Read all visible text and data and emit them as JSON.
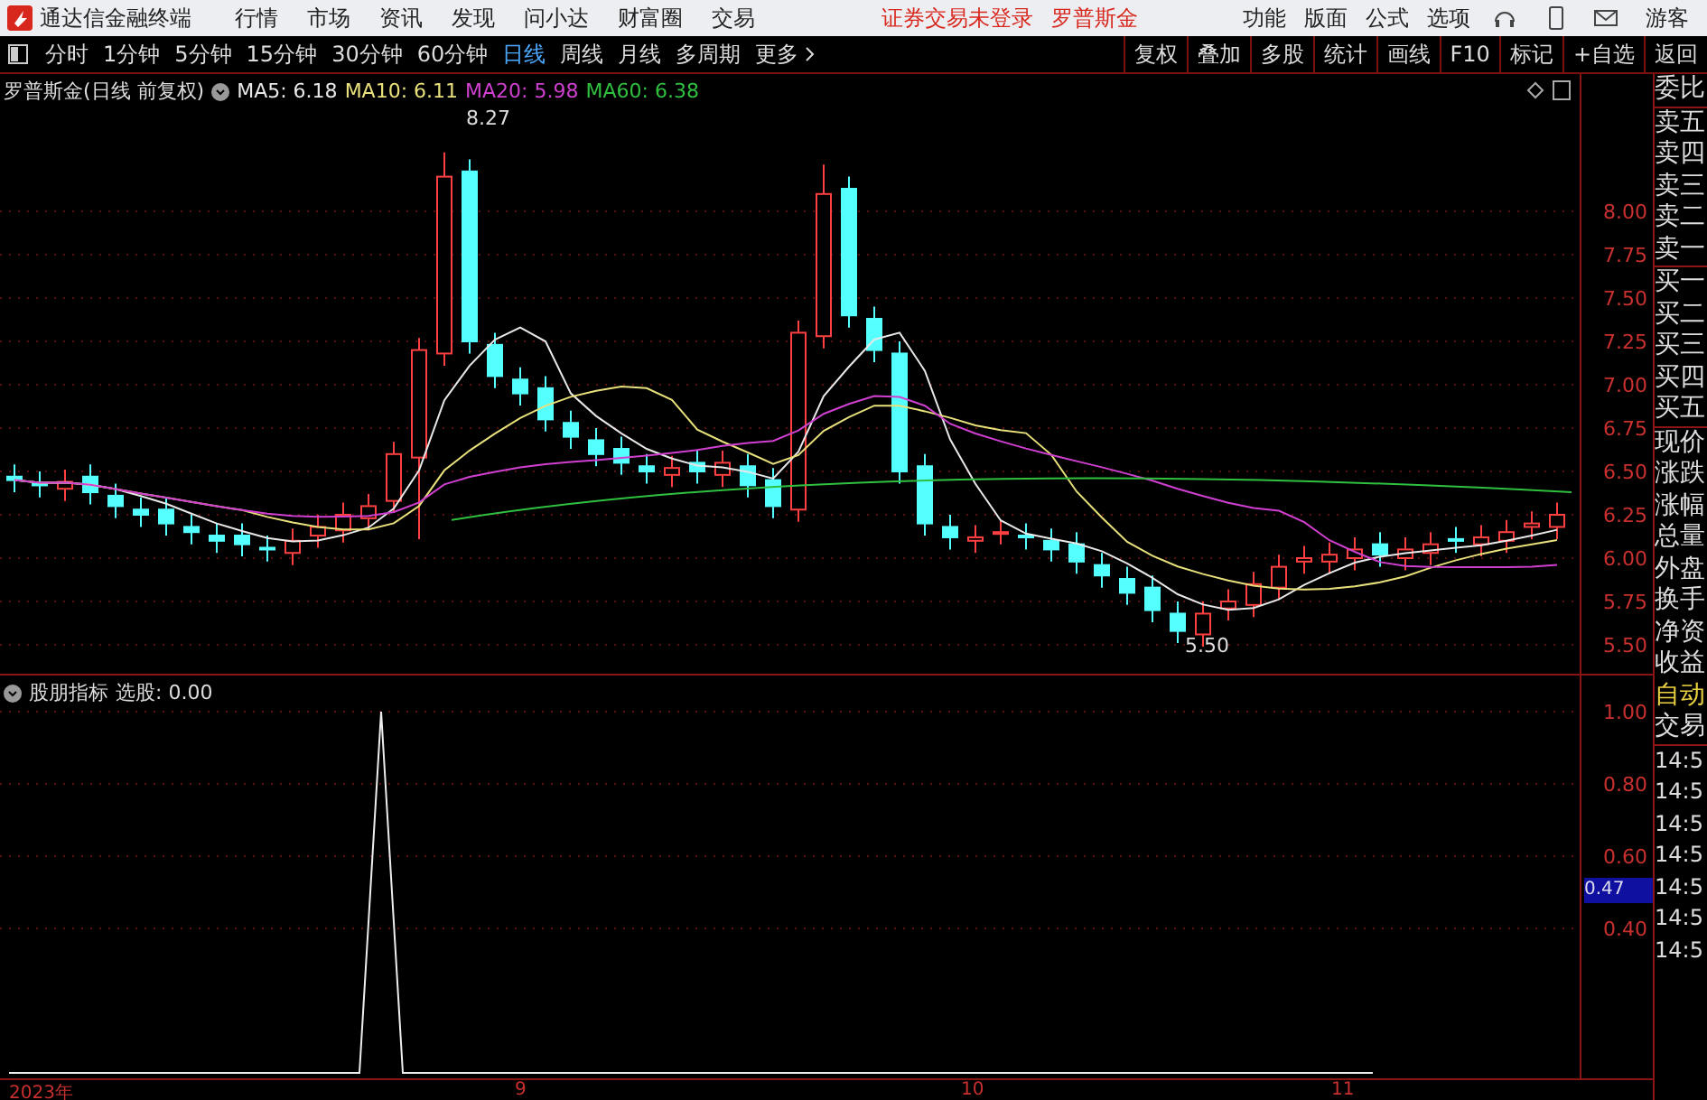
{
  "app": {
    "title": "通达信金融终端"
  },
  "menu": [
    "行情",
    "市场",
    "资讯",
    "发现",
    "问小达",
    "财富圈",
    "交易"
  ],
  "login_status": "证券交易未登录",
  "stock_name": "罗普斯金",
  "top_actions": [
    "功能",
    "版面",
    "公式",
    "选项"
  ],
  "user": "游客",
  "periods": [
    {
      "label": "分时",
      "selected": false
    },
    {
      "label": "1分钟",
      "selected": false
    },
    {
      "label": "5分钟",
      "selected": false
    },
    {
      "label": "15分钟",
      "selected": false
    },
    {
      "label": "30分钟",
      "selected": false
    },
    {
      "label": "60分钟",
      "selected": false
    },
    {
      "label": "日线",
      "selected": true
    },
    {
      "label": "周线",
      "selected": false
    },
    {
      "label": "月线",
      "selected": false
    },
    {
      "label": "多周期",
      "selected": false
    }
  ],
  "more": "更多",
  "tools": [
    "复权",
    "叠加",
    "多股",
    "统计",
    "画线",
    "F10",
    "标记",
    "+自选",
    "返回"
  ],
  "chart": {
    "title": "罗普斯金(日线 前复权)",
    "ma": [
      {
        "label": "MA5: 6.18",
        "color": "#e8e8e8"
      },
      {
        "label": "MA10: 6.11",
        "color": "#e8e07a"
      },
      {
        "label": "MA20: 5.98",
        "color": "#d040d0"
      },
      {
        "label": "MA60: 6.38",
        "color": "#30c040"
      }
    ],
    "high_label": "8.27",
    "low_label": "5.50",
    "yticks": [
      "8.00",
      "7.75",
      "7.50",
      "7.25",
      "7.00",
      "6.75",
      "6.50",
      "6.25",
      "6.00",
      "5.75",
      "5.50"
    ]
  },
  "indicator": {
    "title": "股朋指标",
    "reading": "选股: 0.00",
    "yticks": [
      "1.00",
      "0.80",
      "0.60",
      "0.40"
    ],
    "cursor_value": "0.47"
  },
  "dates": [
    "2023年",
    "9",
    "10",
    "11"
  ],
  "quote_panel": {
    "labels": [
      "委比",
      "卖五",
      "卖四",
      "卖三",
      "卖二",
      "卖一",
      "买一",
      "买二",
      "买三",
      "买四",
      "买五",
      "现价",
      "涨跌",
      "涨幅",
      "总量",
      "外盘",
      "换手",
      "净资",
      "收益"
    ],
    "auto": "自动",
    "trade": "交易",
    "times": [
      "14:5",
      "14:5",
      "14:5",
      "14:5",
      "14:5",
      "14:5",
      "14:5"
    ]
  }
}
